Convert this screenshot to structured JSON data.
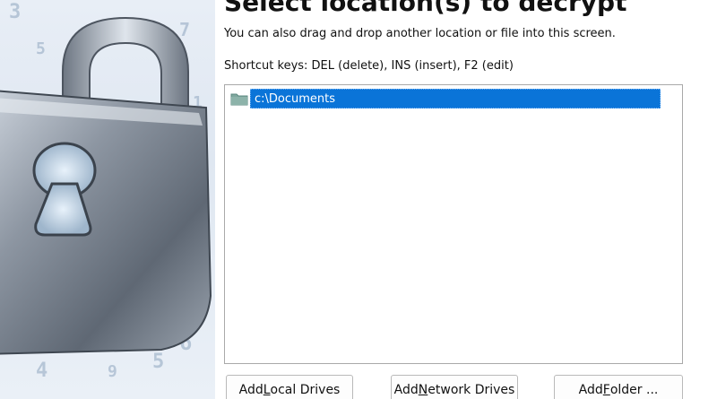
{
  "dialog": {
    "title": "Select location(s) to decrypt",
    "subtitle": "You can also drag and drop another location or file into this screen.",
    "shortcuts": "Shortcut keys: DEL (delete), INS (insert), F2 (edit)"
  },
  "locations": [
    {
      "label": "c:\\Documents",
      "icon": "folder-icon",
      "selected": true
    }
  ],
  "buttons": {
    "add_local_drives": {
      "pre": "Add ",
      "mnemonic": "L",
      "post": "ocal Drives"
    },
    "add_network_drives": {
      "pre": "Add ",
      "mnemonic": "N",
      "post": "etwork Drives"
    },
    "add_folder": {
      "pre": "Add ",
      "mnemonic": "F",
      "post": "older ..."
    }
  },
  "colors": {
    "selection": "#0a74d8",
    "folder": "#7fa79e"
  },
  "decoration": {
    "side_image": "padlock-illustration"
  }
}
